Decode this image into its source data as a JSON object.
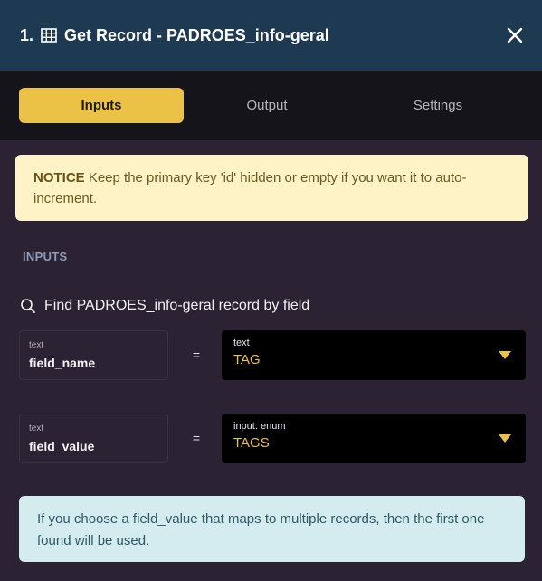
{
  "header": {
    "step_number": "1.",
    "title": "Get Record - PADROES_info-geral",
    "close_icon": "close-icon",
    "table_icon": "table-grid-icon"
  },
  "tabs": [
    {
      "label": "Inputs",
      "active": true
    },
    {
      "label": "Output",
      "active": false
    },
    {
      "label": "Settings",
      "active": false
    }
  ],
  "notice": {
    "label": "NOTICE",
    "text": " Keep the primary key 'id' hidden or empty if you want it to auto-increment."
  },
  "section_label": "INPUTS",
  "find": {
    "icon": "search-icon",
    "text": "Find PADROES_info-geral record by field"
  },
  "rows": [
    {
      "left_type": "text",
      "left_name": "field_name",
      "operator": "=",
      "right_type": "text",
      "right_value": "TAG"
    },
    {
      "left_type": "text",
      "left_name": "field_value",
      "operator": "=",
      "right_type": "input: enum",
      "right_value": "TAGS"
    }
  ],
  "info": {
    "text": "If you choose a field_value that maps to multiple records, then the first one found will be used."
  },
  "colors": {
    "header_bg": "#1e3a52",
    "accent": "#ebc246",
    "notice_bg": "#fdf3c6",
    "info_bg": "#d4ebef"
  }
}
